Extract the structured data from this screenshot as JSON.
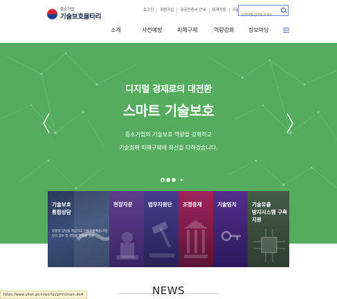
{
  "logo": {
    "sub": "중소기업",
    "main": "기술보호울타리"
  },
  "util_links": [
    "로그인",
    "회원가입",
    "공공인증서 안내",
    "원격지원",
    "기술유출통지"
  ],
  "search": {
    "placeholder": "검색어를 입력해 주세요."
  },
  "nav": [
    "소개",
    "사전예방",
    "피해구제",
    "역량강화",
    "정보마당"
  ],
  "hero": {
    "title_line1": "디지털 경제로의 대전환",
    "title_line2": "스마트 기술보호",
    "desc_line1": "중소기업의 기술보호 역량을 강화하고",
    "desc_line2": "기술침해 피해구제에 최선을 다하겠습니다."
  },
  "cards": [
    {
      "title": [
        "기술보호",
        "통합상담"
      ],
      "desc": [
        "맞춤형 상담을 제공하고 기술유출예방(기업",
        "신고 접수 및 경쟁을 완제를 지원"
      ]
    },
    {
      "title": [
        "현장자문"
      ]
    },
    {
      "title": [
        "법무지원단"
      ]
    },
    {
      "title": [
        "조정중재"
      ]
    },
    {
      "title": [
        "기술임치"
      ]
    },
    {
      "title": [
        "기술유출",
        "방지시스템 구축",
        "지원"
      ]
    }
  ],
  "section_heading": "NEWS",
  "status_bar_url": "https://www.ultari.go.kr/portal/pmm/main.do#",
  "colors": {
    "hero_bg": "#56ac5e",
    "brand_navy": "#1d2b4f",
    "accent_blue": "#3c6ad1"
  }
}
